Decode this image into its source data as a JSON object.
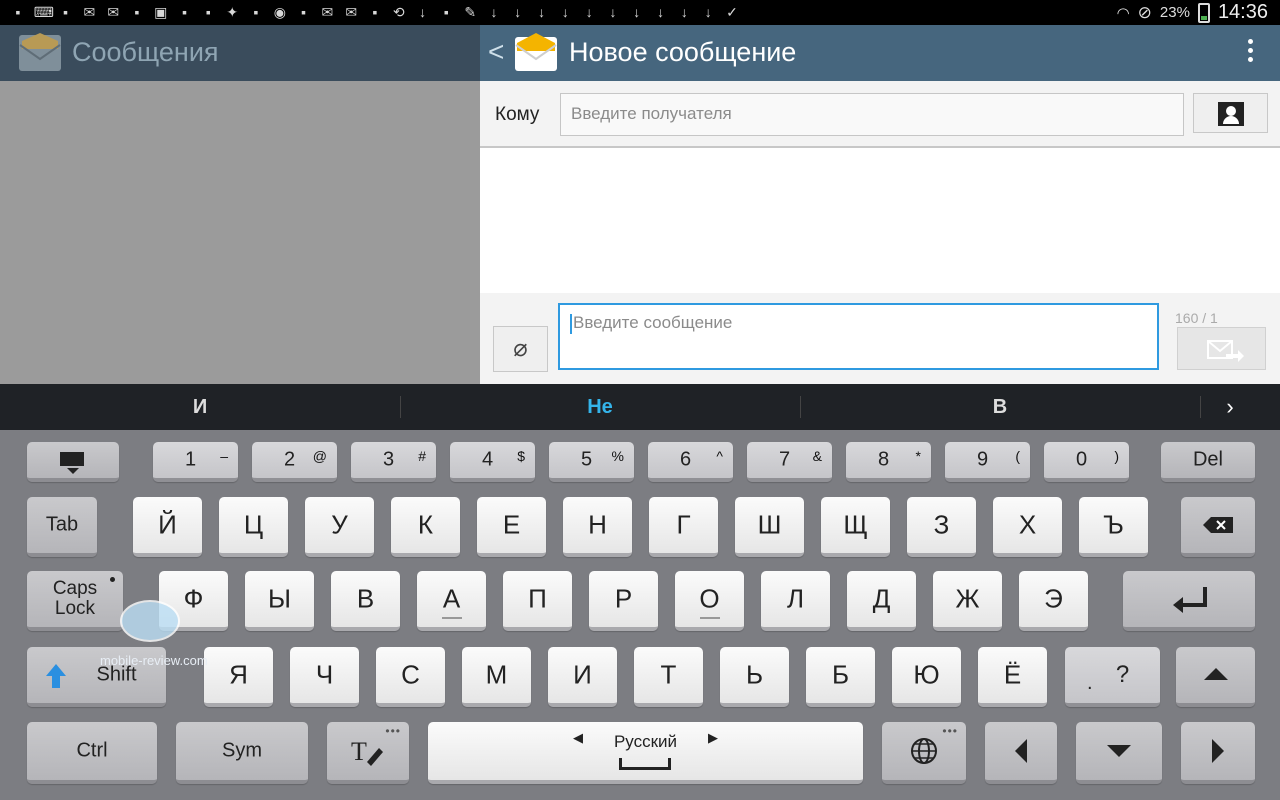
{
  "status_bar": {
    "left_icons": [
      "google-plus-icon",
      "keyboard-icon",
      "sim-icon",
      "mail-icon",
      "gmail-icon",
      "dropbox-icon",
      "image-icon",
      "wordpress-icon",
      "vimeo-icon",
      "twitter-icon",
      "nytimes-icon",
      "chat-icon",
      "screenshot-icon",
      "email-icon",
      "gmail-icon",
      "bag-icon",
      "sync-icon",
      "download-icon",
      "app-icon",
      "pin-icon",
      "download-icon",
      "download-icon",
      "download-icon",
      "download-icon",
      "download-icon",
      "download-icon",
      "download-icon",
      "download-icon",
      "download-icon",
      "download-icon",
      "check-icon"
    ],
    "battery": "23%",
    "clock": "14:36"
  },
  "left_pane": {
    "title": "Сообщения"
  },
  "header": {
    "title": "Новое сообщение"
  },
  "compose": {
    "to_label": "Кому",
    "recipient_placeholder": "Введите получателя",
    "message_placeholder": "Введите сообщение",
    "counter": "160 / 1"
  },
  "suggestions": [
    "И",
    "Не",
    "В"
  ],
  "keyboard": {
    "row0": [
      {
        "l": "1",
        "s": "–"
      },
      {
        "l": "2",
        "s": "@"
      },
      {
        "l": "3",
        "s": "#"
      },
      {
        "l": "4",
        "s": "$"
      },
      {
        "l": "5",
        "s": "%"
      },
      {
        "l": "6",
        "s": "^"
      },
      {
        "l": "7",
        "s": "&"
      },
      {
        "l": "8",
        "s": "*"
      },
      {
        "l": "9",
        "s": "("
      },
      {
        "l": "0",
        "s": ")"
      }
    ],
    "row1": [
      "Й",
      "Ц",
      "У",
      "К",
      "Е",
      "Н",
      "Г",
      "Ш",
      "Щ",
      "З",
      "Х",
      "Ъ"
    ],
    "row2": [
      "Ф",
      "Ы",
      "В",
      "А",
      "П",
      "Р",
      "О",
      "Л",
      "Д",
      "Ж",
      "Э"
    ],
    "row3": [
      "Я",
      "Ч",
      "С",
      "М",
      "И",
      "Т",
      "Ь",
      "Б",
      "Ю",
      "Ё"
    ],
    "del": "Del",
    "tab": "Tab",
    "caps": "Caps Lock",
    "shift": "Shift",
    "ctrl": "Ctrl",
    "sym": "Sym",
    "language": "Русский",
    "punct_main": "?",
    "punct_sub": "."
  },
  "watermark": "mobile-review.com",
  "colors": {
    "accent": "#2f9ae0",
    "header": "#46667e",
    "keyboard": "#7c7d82"
  }
}
